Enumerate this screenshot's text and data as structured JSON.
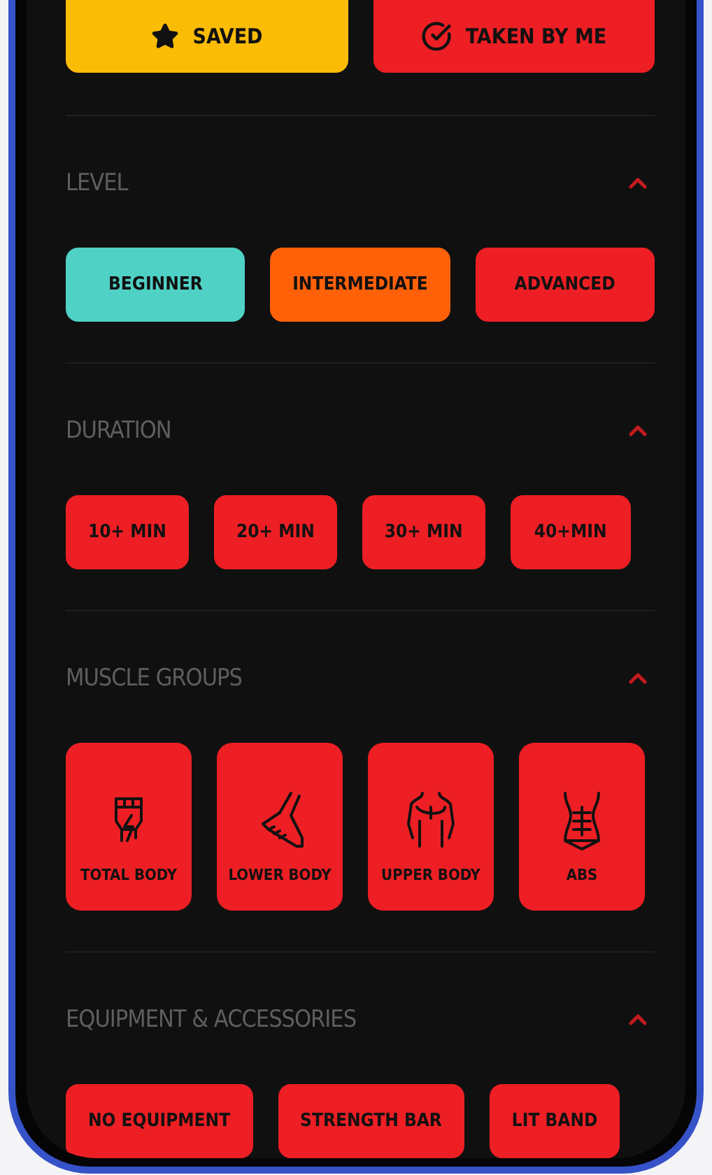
{
  "top_buttons": [
    {
      "kind": "saved",
      "label": "SAVED",
      "color": "#fbbc05"
    },
    {
      "kind": "taken",
      "label": "TAKEN BY ME",
      "color": "#ed1f24"
    }
  ],
  "sections": [
    {
      "kind": "equal_chips",
      "title": "LEVEL",
      "expanded": true,
      "items": [
        {
          "label": "BEGINNER",
          "color": "#4fd1c5"
        },
        {
          "label": "INTERMEDIATE",
          "color": "#ff6109"
        },
        {
          "label": "ADVANCED",
          "color": "#ed1f24"
        }
      ]
    },
    {
      "kind": "chips",
      "title": "DURATION",
      "expanded": true,
      "items": [
        {
          "label": "10+ MIN",
          "color": "#ed1f24"
        },
        {
          "label": "20+ MIN",
          "color": "#ed1f24"
        },
        {
          "label": "30+ MIN",
          "color": "#ed1f24"
        },
        {
          "label": "40+MIN",
          "color": "#ed1f24"
        }
      ]
    },
    {
      "kind": "tiles",
      "title": "MUSCLE GROUPS",
      "expanded": true,
      "items": [
        {
          "label": "TOTAL BODY",
          "kind": "fist"
        },
        {
          "label": "LOWER BODY",
          "kind": "leg"
        },
        {
          "label": "UPPER BODY",
          "kind": "chest"
        },
        {
          "label": "ABS",
          "kind": "abs"
        }
      ]
    },
    {
      "kind": "chips",
      "title": "EQUIPMENT & ACCESSORIES",
      "expanded": true,
      "items": [
        {
          "label": "NO EQUIPMENT",
          "color": "#ed1f24"
        },
        {
          "label": "STRENGTH BAR",
          "color": "#ed1f24"
        },
        {
          "label": "LIT BAND",
          "color": "#ed1f24"
        }
      ]
    }
  ]
}
